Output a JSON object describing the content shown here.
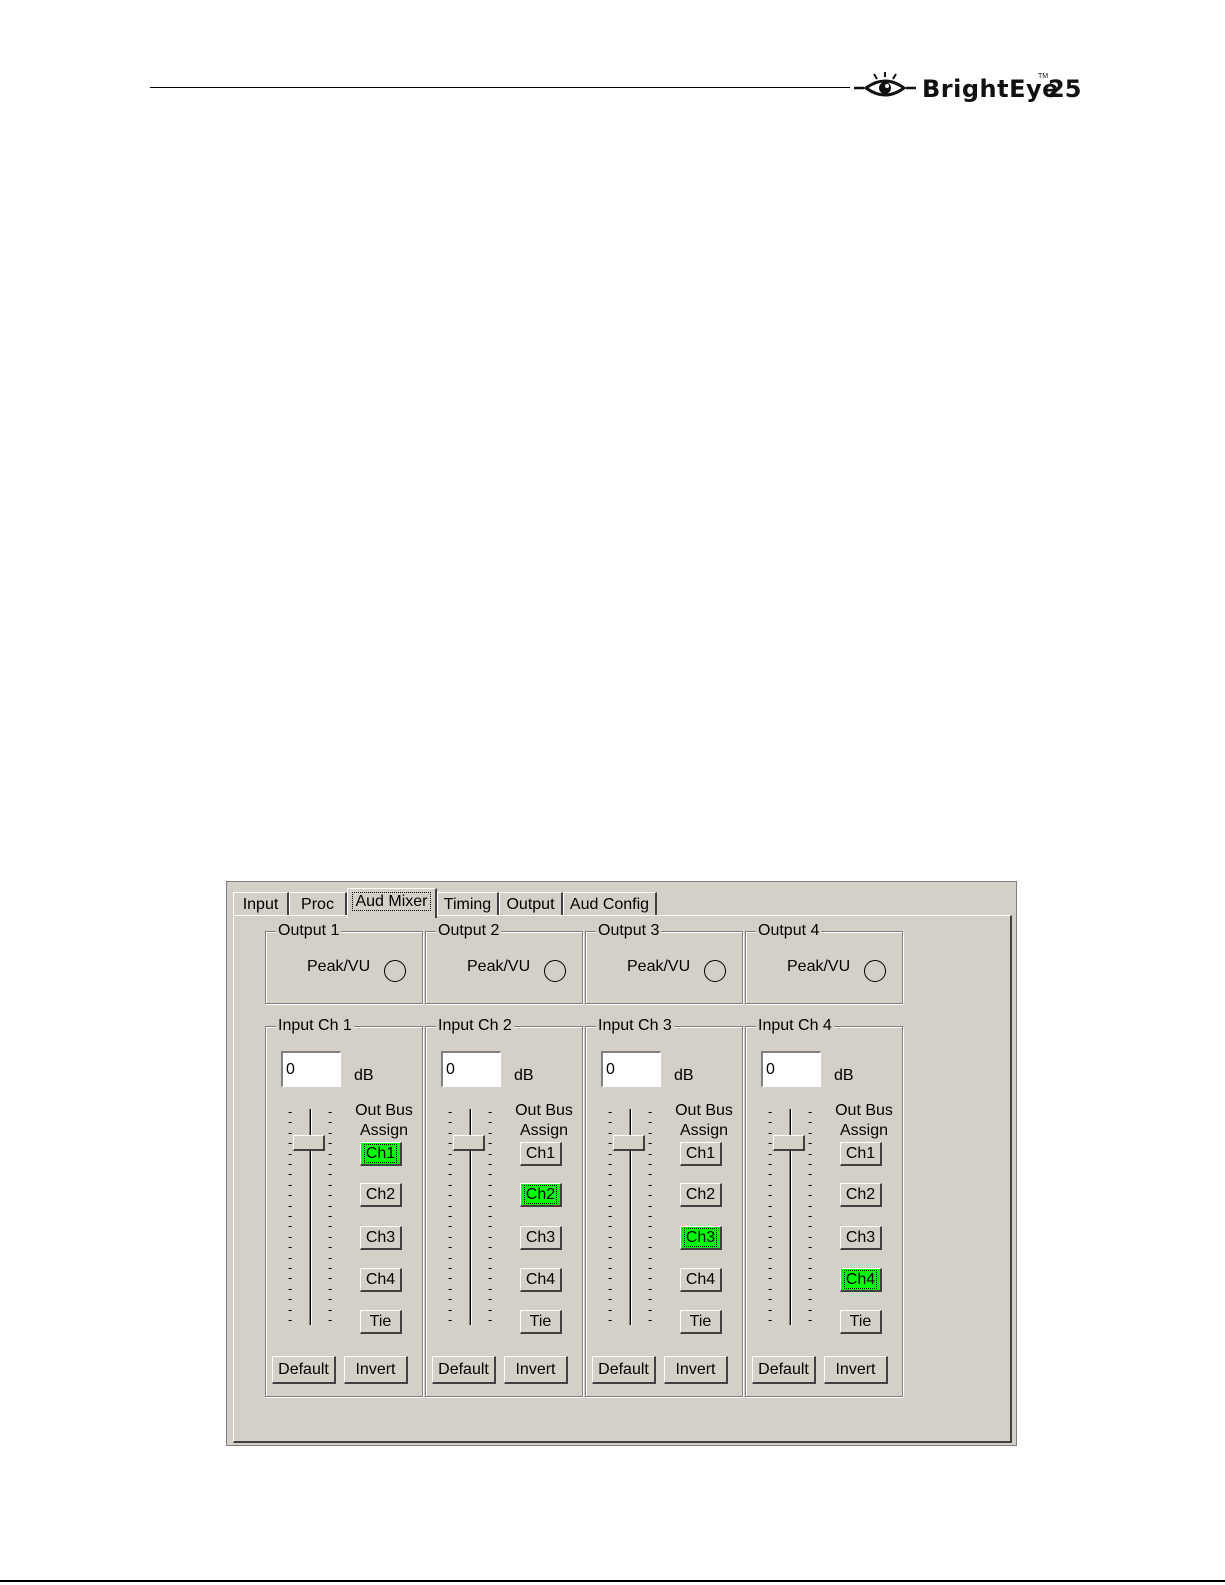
{
  "header": {
    "logo_word": "BrightEye",
    "logo_tm": "TM",
    "logo_num": "25"
  },
  "tabs": [
    {
      "label": "Input",
      "active": false
    },
    {
      "label": "Proc",
      "active": false
    },
    {
      "label": "Aud Mixer",
      "active": true
    },
    {
      "label": "Timing",
      "active": false
    },
    {
      "label": "Output",
      "active": false
    },
    {
      "label": "Aud Config",
      "active": false
    }
  ],
  "outputs": [
    {
      "title": "Output 1",
      "label": "Peak/VU"
    },
    {
      "title": "Output 2",
      "label": "Peak/VU"
    },
    {
      "title": "Output 3",
      "label": "Peak/VU"
    },
    {
      "title": "Output 4",
      "label": "Peak/VU"
    }
  ],
  "inputs": [
    {
      "title": "Input Ch 1",
      "db_value": "0",
      "db_unit": "dB",
      "bus_label_1": "Out Bus",
      "bus_label_2": "Assign",
      "buttons": [
        "Ch1",
        "Ch2",
        "Ch3",
        "Ch4",
        "Tie"
      ],
      "active_button": "Ch1",
      "default_label": "Default",
      "invert_label": "Invert"
    },
    {
      "title": "Input Ch 2",
      "db_value": "0",
      "db_unit": "dB",
      "bus_label_1": "Out Bus",
      "bus_label_2": "Assign",
      "buttons": [
        "Ch1",
        "Ch2",
        "Ch3",
        "Ch4",
        "Tie"
      ],
      "active_button": "Ch2",
      "default_label": "Default",
      "invert_label": "Invert"
    },
    {
      "title": "Input Ch 3",
      "db_value": "0",
      "db_unit": "dB",
      "bus_label_1": "Out Bus",
      "bus_label_2": "Assign",
      "buttons": [
        "Ch1",
        "Ch2",
        "Ch3",
        "Ch4",
        "Tie"
      ],
      "active_button": "Ch3",
      "default_label": "Default",
      "invert_label": "Invert"
    },
    {
      "title": "Input Ch 4",
      "db_value": "0",
      "db_unit": "dB",
      "bus_label_1": "Out Bus",
      "bus_label_2": "Assign",
      "buttons": [
        "Ch1",
        "Ch2",
        "Ch3",
        "Ch4",
        "Tie"
      ],
      "active_button": "Ch4",
      "default_label": "Default",
      "invert_label": "Invert"
    }
  ],
  "colors": {
    "window_bg": "#d4d0c8",
    "active_button": "#00ff00"
  }
}
